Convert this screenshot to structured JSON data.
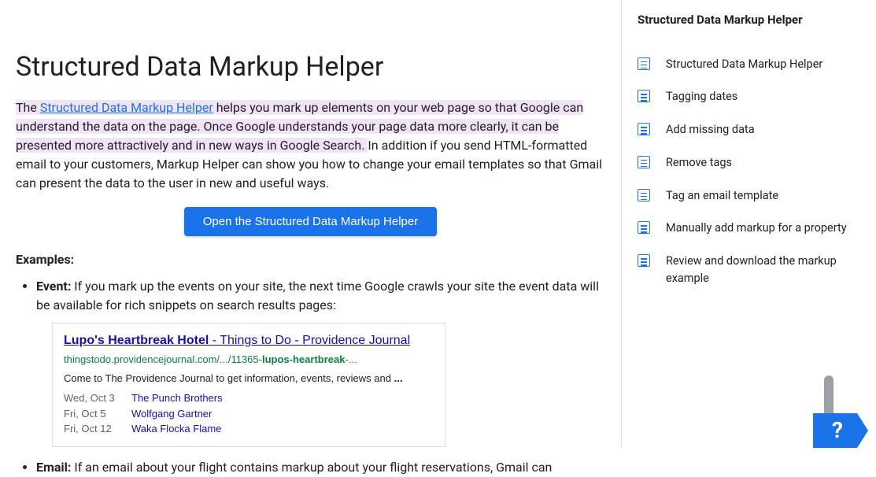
{
  "page": {
    "title": "Structured Data Markup Helper",
    "intro": {
      "hl_prefix": "The ",
      "link": "Structured Data Markup Helper",
      "hl_suffix": " helps you mark up elements on your web page so that Google can understand the data on the page. Once Google understands your page data more clearly, it can be presented more attractively and in new ways in Google Search.",
      "rest": " In addition if you send HTML-formatted email to your customers, Markup Helper can show you how to change your email templates so that Gmail can present the data to the user in new and useful ways."
    },
    "button": "Open the Structured Data Markup Helper",
    "examples_label": "Examples:",
    "event": {
      "label": "Event:",
      "text": " If you mark up the events on your site, the next time Google crawls your site the event data will be available for rich snippets on search results pages:"
    },
    "email": {
      "label": "Email:",
      "text": " If an email about your flight contains markup about your flight reservations, Gmail can"
    },
    "snippet": {
      "title_link": "Lupo's Heartbreak Hotel",
      "title_rest": " - Things to Do - Providence Journal",
      "url_pre": "thingstodo.providencejournal.com/.../11365-",
      "url_bold": "lupos-heartbreak",
      "url_post": "-...",
      "desc_pre": "Come to The Providence Journal to get information, events, reviews and ",
      "desc_bold": "...",
      "events": [
        {
          "date": "Wed, Oct 3",
          "name": "The Punch Brothers"
        },
        {
          "date": "Fri, Oct 5",
          "name": "Wolfgang Gartner"
        },
        {
          "date": "Fri, Oct 12",
          "name": "Waka Flocka Flame"
        }
      ]
    }
  },
  "sidebar": {
    "title": "Structured Data Markup Helper",
    "items": [
      {
        "label": "Structured Data Markup Helper"
      },
      {
        "label": "Tagging dates"
      },
      {
        "label": "Add missing data"
      },
      {
        "label": "Remove tags"
      },
      {
        "label": "Tag an email template"
      },
      {
        "label": "Manually add markup for a property"
      },
      {
        "label": "Review and download the markup example"
      }
    ],
    "help": "?"
  }
}
